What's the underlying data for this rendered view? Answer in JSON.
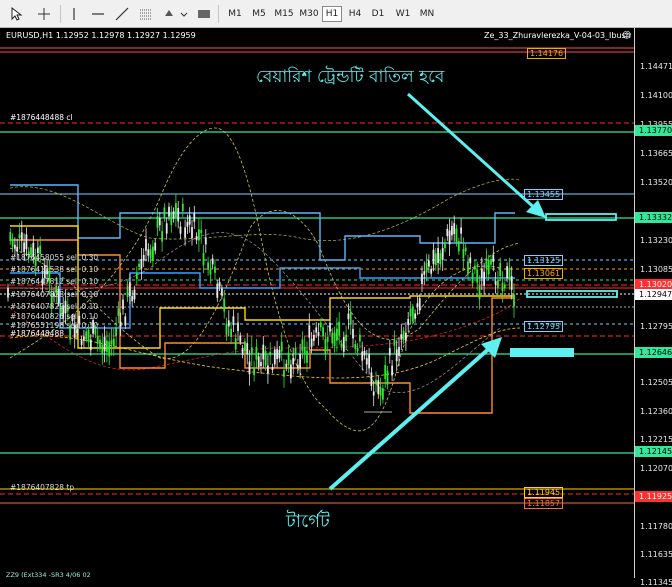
{
  "toolbar": {
    "icons": [
      "cursor-arrow-icon",
      "crosshair-icon",
      "vertical-line-icon",
      "horizontal-line-icon",
      "trendline-icon",
      "channel-icon",
      "text-shapes-icon",
      "chart-type-icon"
    ],
    "timeframes": [
      "M1",
      "M5",
      "M15",
      "M30",
      "H1",
      "H4",
      "D1",
      "W1",
      "MN"
    ],
    "active_timeframe": "H1"
  },
  "chart": {
    "symbol_info": "EURUSD,H1  1.12952 1.12978 1.12927 1.12959",
    "expert_name": "Ze_33_Zhuravlerezka_V-04-03_Ibush",
    "bottom_text": "ZZ9 (Ext334 -SR3 4/06 02",
    "order_labels": [
      "#1876448488 cl",
      "#1876458055 sell 0.30",
      "#1876411538 sell 0.10",
      "#1876447812 sell 0.10",
      "#1876407828 sell 0.10",
      "#1876407829 sell 0.10",
      "#1876440826 sell 0.10",
      "#1876551198 sell 0.10",
      "#1876448488",
      "#1876407828 tp"
    ],
    "levels": [
      {
        "label": "1.14176",
        "color": "#ffa500"
      },
      {
        "label": "1.13455",
        "color": "#7ad3ff"
      },
      {
        "label": "1.13125",
        "color": "#7ad3ff"
      },
      {
        "label": "1.13061",
        "color": "#ffa500"
      },
      {
        "label": "1.12795",
        "color": "#7ad3ff"
      },
      {
        "label": "1.11945",
        "color": "#ffd700"
      },
      {
        "label": "1.11857",
        "color": "#ff6b3d"
      }
    ]
  },
  "price_axis": {
    "ticks": [
      "1.14471",
      "1.14100",
      "1.13955",
      "1.13665",
      "1.13520",
      "1.13230",
      "1.13085",
      "1.12795",
      "1.12505",
      "1.12360",
      "1.12215",
      "1.12070",
      "1.11780",
      "1.11635",
      "1.11345"
    ],
    "highlights": [
      {
        "label": "1.13770",
        "bg": "#32e89a"
      },
      {
        "label": "1.13332",
        "bg": "#32e89a"
      },
      {
        "label": "1.13020",
        "bg": "#ff3030"
      },
      {
        "label": "1.12947",
        "bg": "#ffffff"
      },
      {
        "label": "1.12646",
        "bg": "#32e89a"
      },
      {
        "label": "1.12145",
        "bg": "#32e89a"
      },
      {
        "label": "1.11925",
        "bg": "#ff3030"
      }
    ]
  },
  "annotations": {
    "top_text": "বেয়ারিশ ট্রেন্ডটি বাতিল হবে",
    "bottom_text": "টার্গেট"
  },
  "colors": {
    "up_candle": "#32e832",
    "annotation": "#5ef0f0",
    "support": "#32e89a",
    "resistance_dash": "#ff2a2a"
  }
}
